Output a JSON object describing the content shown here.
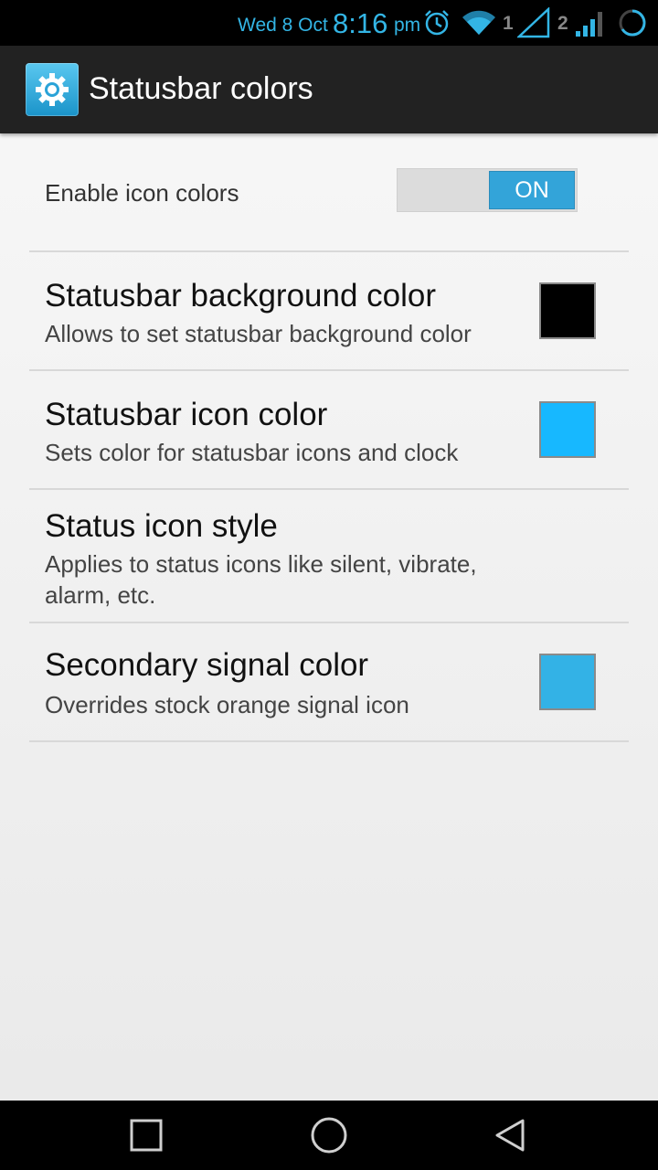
{
  "statusbar": {
    "date": "Wed 8 Oct",
    "time": "8:16",
    "ampm": "pm",
    "sim1": "1",
    "sim2": "2",
    "icons": [
      "alarm-icon",
      "wifi-icon",
      "signal-icon",
      "signal-icon",
      "battery-icon"
    ],
    "accent": "#33b5e5"
  },
  "actionbar": {
    "title": "Statusbar colors",
    "app_icon": "settings-gear-icon",
    "background": "#222222"
  },
  "enable_toggle": {
    "label": "Enable icon colors",
    "state": "ON"
  },
  "prefs": [
    {
      "title": "Statusbar background color",
      "summary": "Allows to set statusbar background color",
      "swatch": "#000000"
    },
    {
      "title": "Statusbar icon color",
      "summary": "Sets color for statusbar icons and clock",
      "swatch": "#17b8ff"
    },
    {
      "title": "Status icon style",
      "summary": "Applies to status icons like silent, vibrate, alarm, etc."
    },
    {
      "title": "Secondary signal color",
      "summary": "Overrides stock orange signal icon",
      "swatch": "#33b2e6"
    }
  ],
  "navbar": {
    "buttons": [
      "recents-icon",
      "home-icon",
      "back-icon"
    ]
  }
}
